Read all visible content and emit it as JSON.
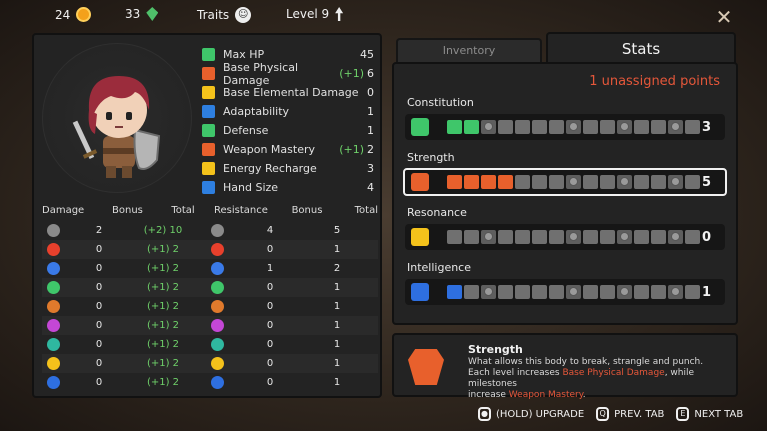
{
  "topbar": {
    "gold": "24",
    "gems": "33",
    "traits_label": "Traits",
    "level_label": "Level 9"
  },
  "attributes": [
    {
      "label": "Max HP",
      "bonus": "",
      "value": "45",
      "icon": "heart-icon",
      "color": "#3fc66a"
    },
    {
      "label": "Base Physical Damage",
      "bonus": "(+1)",
      "value": "6",
      "icon": "fist-icon",
      "color": "#e8602c"
    },
    {
      "label": "Base Elemental Damage",
      "bonus": "",
      "value": "0",
      "icon": "flame-icon",
      "color": "#f4c21b"
    },
    {
      "label": "Adaptability",
      "bonus": "",
      "value": "1",
      "icon": "puzzle-icon",
      "color": "#2e7fe0"
    },
    {
      "label": "Defense",
      "bonus": "",
      "value": "1",
      "icon": "shield-icon",
      "color": "#3fc66a"
    },
    {
      "label": "Weapon Mastery",
      "bonus": "(+1)",
      "value": "2",
      "icon": "swords-icon",
      "color": "#e8602c"
    },
    {
      "label": "Energy Recharge",
      "bonus": "",
      "value": "3",
      "icon": "spark-icon",
      "color": "#f4c21b"
    },
    {
      "label": "Hand Size",
      "bonus": "",
      "value": "4",
      "icon": "cards-icon",
      "color": "#2e7fe0"
    }
  ],
  "damage_table": {
    "headers": [
      "Damage",
      "Bonus",
      "Total",
      "Resistance",
      "Bonus",
      "Total"
    ],
    "rows": [
      {
        "icon": "physical-icon",
        "color": "#8a8a8a",
        "dmg_bonus": "2",
        "dmg_total_bonus": "(+2)",
        "dmg_total": "10",
        "res_bonus": "4",
        "res_total": "5"
      },
      {
        "icon": "fire-icon",
        "color": "#e8402c",
        "dmg_bonus": "0",
        "dmg_total_bonus": "(+1)",
        "dmg_total": "2",
        "res_bonus": "0",
        "res_total": "1"
      },
      {
        "icon": "ice-icon",
        "color": "#3a7ae8",
        "dmg_bonus": "0",
        "dmg_total_bonus": "(+1)",
        "dmg_total": "2",
        "res_bonus": "1",
        "res_total": "2"
      },
      {
        "icon": "poison-icon",
        "color": "#3fc66a",
        "dmg_bonus": "0",
        "dmg_total_bonus": "(+1)",
        "dmg_total": "2",
        "res_bonus": "0",
        "res_total": "1"
      },
      {
        "icon": "earth-icon",
        "color": "#e07a2c",
        "dmg_bonus": "0",
        "dmg_total_bonus": "(+1)",
        "dmg_total": "2",
        "res_bonus": "0",
        "res_total": "1"
      },
      {
        "icon": "arcane-icon",
        "color": "#c447d6",
        "dmg_bonus": "0",
        "dmg_total_bonus": "(+1)",
        "dmg_total": "2",
        "res_bonus": "0",
        "res_total": "1"
      },
      {
        "icon": "wind-icon",
        "color": "#2fb8a0",
        "dmg_bonus": "0",
        "dmg_total_bonus": "(+1)",
        "dmg_total": "2",
        "res_bonus": "0",
        "res_total": "1"
      },
      {
        "icon": "lightning-icon",
        "color": "#f4c21b",
        "dmg_bonus": "0",
        "dmg_total_bonus": "(+1)",
        "dmg_total": "2",
        "res_bonus": "0",
        "res_total": "1"
      },
      {
        "icon": "water-icon",
        "color": "#2e6fe0",
        "dmg_bonus": "0",
        "dmg_total_bonus": "(+1)",
        "dmg_total": "2",
        "res_bonus": "0",
        "res_total": "1"
      }
    ]
  },
  "tabs": {
    "inventory": "Inventory",
    "stats": "Stats"
  },
  "unassigned": "1 unassigned points",
  "stats": [
    {
      "name": "Constitution",
      "value": "3",
      "filled": 2,
      "color": "#3fc66a",
      "icon": "constitution-icon",
      "selected": false
    },
    {
      "name": "Strength",
      "value": "5",
      "filled": 4,
      "color": "#e8602c",
      "icon": "strength-icon",
      "selected": true
    },
    {
      "name": "Resonance",
      "value": "0",
      "filled": 0,
      "color": "#f4c21b",
      "icon": "resonance-icon",
      "selected": false
    },
    {
      "name": "Intelligence",
      "value": "1",
      "filled": 1,
      "color": "#2e6fe0",
      "icon": "intelligence-icon",
      "selected": false
    }
  ],
  "description": {
    "title": "Strength",
    "line1": "What allows this body to break, strangle and punch.",
    "line2_a": "Each level increases ",
    "line2_hl": "Base Physical Damage",
    "line2_b": ", while milestones",
    "line3_a": "increase ",
    "line3_hl": "Weapon Mastery",
    "line3_b": "."
  },
  "hints": {
    "upgrade": "(HOLD) UPGRADE",
    "prev_key": "Q",
    "prev": "PREV. TAB",
    "next_key": "E",
    "next": "NEXT TAB"
  }
}
